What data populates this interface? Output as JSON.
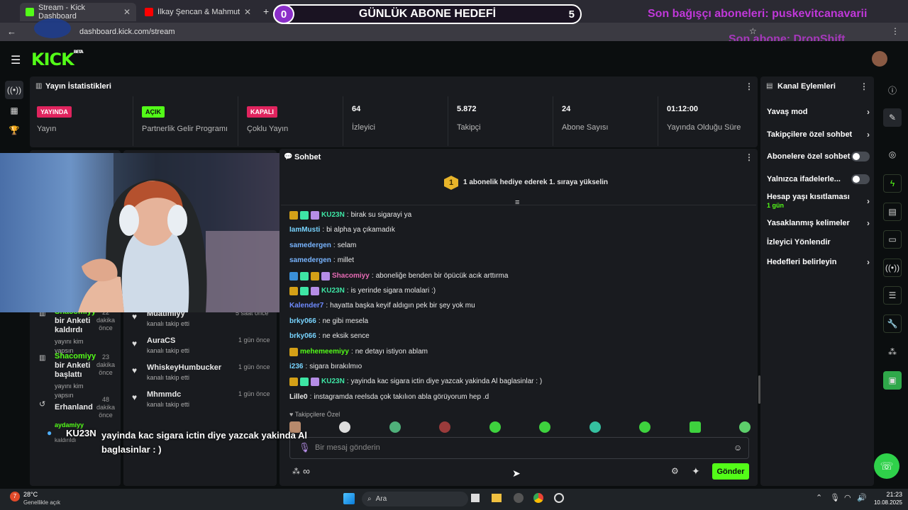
{
  "browser": {
    "tabs": [
      {
        "label": "Stream - Kick Dashboard",
        "active": true
      },
      {
        "label": "İlkay Şencan & Mahmut Orhan",
        "active": false
      }
    ],
    "url": "dashboard.kick.com/stream"
  },
  "overlay": {
    "goal_title": "GÜNLÜK ABONE HEDEFİ",
    "goal_current": "0",
    "goal_target": "5",
    "last_gifter": "Son bağışçı aboneleri: puskevitcanavarii",
    "last_sub": "Son abone: DropShift",
    "chat_popup_user": "KU23N",
    "chat_popup_text": "yayinda kac sigara ictin diye yazcak yakinda Al baglasinlar : )"
  },
  "logo": {
    "text": "KICK",
    "beta": "BETA"
  },
  "stats": {
    "title": "Yayın İstatistikleri",
    "items": [
      {
        "badge": "YAYINDA",
        "label": "Yayın",
        "color": "#e0245e"
      },
      {
        "badge": "AÇIK",
        "label": "Partnerlik Gelir Programı",
        "color": "#53fc18"
      },
      {
        "badge": "KAPALI",
        "label": "Çoklu Yayın",
        "color": "#e0245e"
      },
      {
        "value": "64",
        "label": "İzleyici"
      },
      {
        "value": "5.872",
        "label": "Takipçi"
      },
      {
        "value": "24",
        "label": "Abone Sayısı"
      },
      {
        "value": "01:12:00",
        "label": "Yayında Olduğu Süre"
      }
    ]
  },
  "activity_feed": [
    {
      "user": "Shacomiyy",
      "action": "bir Anketi kaldırdı",
      "sub": "yayını kim yapsın",
      "time": "22 dakika önce"
    },
    {
      "user": "Shacomiyy",
      "action": "bir Anketi başlattı",
      "sub": "yayını kim yapsın",
      "time": "23 dakika önce"
    },
    {
      "user": "Erhanland",
      "action": "",
      "sub": "",
      "time": "48 dakika önce"
    },
    {
      "user": "aydamiyy",
      "action": "",
      "sub": "kaldırıldı",
      "time": ""
    }
  ],
  "followers_feed": [
    {
      "user": "Muatlmiyy",
      "sub": "kanalı takip etti",
      "time": "5 saat önce"
    },
    {
      "user": "AuraCS",
      "sub": "kanalı takip etti",
      "time": "1 gün önce"
    },
    {
      "user": "WhiskeyHumbucker",
      "sub": "kanalı takip etti",
      "time": "1 gün önce"
    },
    {
      "user": "Mhmmdc",
      "sub": "kanalı takip etti",
      "time": "1 gün önce"
    }
  ],
  "chat": {
    "title": "Sohbet",
    "gift_banner": "1 abonelik hediye ederek 1. sıraya yükselin",
    "gift_rank": "1",
    "messages": [
      {
        "user": "KU23N",
        "text": "birak su sigarayi ya",
        "color": "#3ee6a5",
        "badges": [
          "#d4a017",
          "#3ee6a5",
          "#b58de6"
        ]
      },
      {
        "user": "IamMusti",
        "text": "bi alpha ya çıkamadık",
        "color": "#78d4ff",
        "badges": []
      },
      {
        "user": "samedergen",
        "text": "selam",
        "color": "#78b4ff",
        "badges": []
      },
      {
        "user": "samedergen",
        "text": "millet",
        "color": "#78b4ff",
        "badges": []
      },
      {
        "user": "Shacomiyy",
        "text": "aboneliğe benden bir öpücük acık arttırma",
        "color": "#e86bb5",
        "badges": [
          "#3a8fd8",
          "#3ee6a5",
          "#d4a017",
          "#b58de6"
        ]
      },
      {
        "user": "KU23N",
        "text": "is yerinde sigara molalari :)",
        "color": "#3ee6a5",
        "badges": [
          "#d4a017",
          "#3ee6a5",
          "#b58de6"
        ]
      },
      {
        "user": "Kalender7",
        "text": "hayatta başka keyif aldıgın pek bir şey yok mu",
        "color": "#6f8bff",
        "badges": []
      },
      {
        "user": "brky066",
        "text": "ne gibi mesela",
        "color": "#78d4ff",
        "badges": []
      },
      {
        "user": "brky066",
        "text": "ne eksik sence",
        "color": "#78d4ff",
        "badges": []
      },
      {
        "user": "mehemeemiyy",
        "text": "ne detayı istiyon ablam",
        "color": "#53fc18",
        "badges": [
          "#d4a017"
        ]
      },
      {
        "user": "i236",
        "text": "sigara bırakılmıo",
        "color": "#78d4ff",
        "badges": []
      },
      {
        "user": "KU23N",
        "text": "yayinda kac sigara ictin diye yazcak yakinda Al baglasinlar : )",
        "color": "#3ee6a5",
        "badges": [
          "#d4a017",
          "#3ee6a5",
          "#b58de6"
        ]
      },
      {
        "user": "Lille0",
        "text": "instagramda reelsda çok takılıon abla görüyorum hep .d",
        "color": "#e8e8e8",
        "badges": []
      }
    ],
    "followers_only_label": "Takipçilere Özel",
    "input_placeholder": "Bir mesaj gönderin",
    "send_label": "Gönder",
    "infinity_label": "∞"
  },
  "channel_actions": {
    "title": "Kanal Eylemleri",
    "items": [
      {
        "label": "Yavaş mod",
        "kind": "chevron"
      },
      {
        "label": "Takipçilere özel sohbet",
        "kind": "chevron"
      },
      {
        "label": "Abonelere özel sohbet",
        "kind": "toggle"
      },
      {
        "label": "Yalnızca ifadelerle...",
        "kind": "toggle"
      },
      {
        "label": "Hesap yaşı kısıtlaması",
        "kind": "chevron",
        "sub": "1 gün"
      },
      {
        "label": "Yasaklanmış kelimeler",
        "kind": "chevron"
      },
      {
        "label": "İzleyici Yönlendir",
        "kind": "none"
      },
      {
        "label": "Hedefleri belirleyin",
        "kind": "chevron"
      }
    ]
  },
  "taskbar": {
    "weather_temp": "28°C",
    "weather_desc": "Genellikle açık",
    "weather_badge": "7",
    "search_label": "Ara",
    "time": "21:23",
    "date": "10.08.2025"
  }
}
